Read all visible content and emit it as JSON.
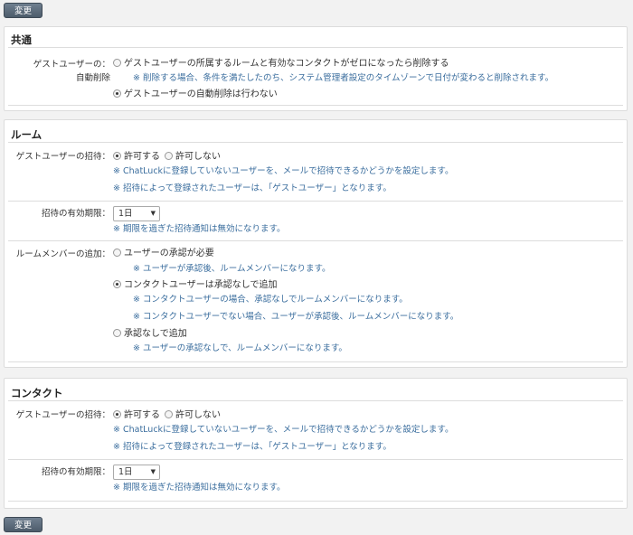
{
  "buttons": {
    "change_label": "変更"
  },
  "common": {
    "title": "共通",
    "guest_autodelete": {
      "label_line1": "ゲストユーザーの：",
      "label_line2": "自動削除",
      "option1": "ゲストユーザーの所属するルームと有効なコンタクトがゼロになったら削除する",
      "option1_note": "※ 削除する場合、条件を満たしたのち、システム管理者設定のタイムゾーンで日付が変わると削除されます。",
      "option2": "ゲストユーザーの自動削除は行わない",
      "selected": 2
    }
  },
  "room": {
    "title": "ルーム",
    "invite": {
      "label": "ゲストユーザーの招待：",
      "allow": "許可する",
      "deny": "許可しない",
      "note1": "※ ChatLuckに登録していないユーザーを、メールで招待できるかどうかを設定します。",
      "note2": "※ 招待によって登録されたユーザーは、「ゲストユーザー」となります。",
      "selected": "allow"
    },
    "expiry": {
      "label": "招待の有効期限：",
      "value": "1日",
      "note": "※ 期限を過ぎた招待通知は無効になります。"
    },
    "member_add": {
      "label": "ルームメンバーの追加：",
      "opt1": "ユーザーの承認が必要",
      "opt1_note": "※ ユーザーが承認後、ルームメンバーになります。",
      "opt2": "コンタクトユーザーは承認なしで追加",
      "opt2_note1": "※ コンタクトユーザーの場合、承認なしでルームメンバーになります。",
      "opt2_note2": "※ コンタクトユーザーでない場合、ユーザーが承認後、ルームメンバーになります。",
      "opt3": "承認なしで追加",
      "opt3_note": "※ ユーザーの承認なしで、ルームメンバーになります。",
      "selected": 2
    }
  },
  "contact": {
    "title": "コンタクト",
    "invite": {
      "label": "ゲストユーザーの招待：",
      "allow": "許可する",
      "deny": "許可しない",
      "note1": "※ ChatLuckに登録していないユーザーを、メールで招待できるかどうかを設定します。",
      "note2": "※ 招待によって登録されたユーザーは、「ゲストユーザー」となります。",
      "selected": "allow"
    },
    "expiry": {
      "label": "招待の有効期限：",
      "value": "1日",
      "note": "※ 期限を過ぎた招待通知は無効になります。"
    }
  }
}
